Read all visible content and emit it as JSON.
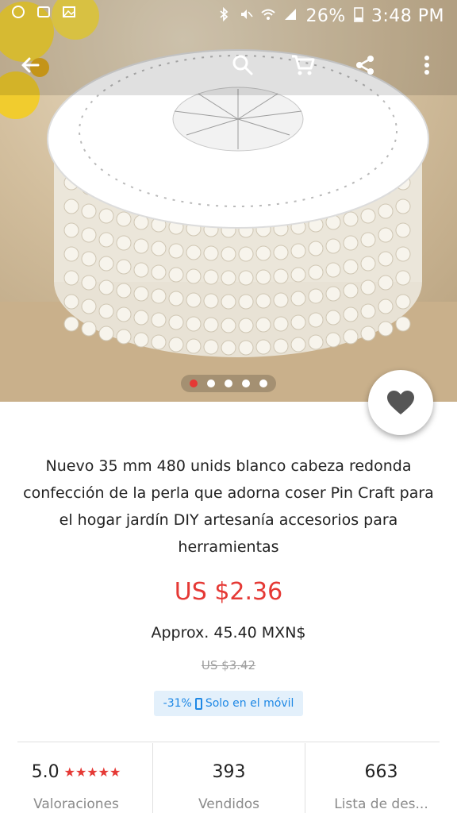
{
  "status_bar": {
    "battery": "26%",
    "time": "3:48 PM"
  },
  "gallery": {
    "total_images": 5,
    "active_index": 0
  },
  "colors": {
    "accent": "#e53935",
    "badge_text": "#1e88e5",
    "badge_bg": "#e3f0fb"
  },
  "product": {
    "title": "Nuevo 35 mm 480 unids blanco cabeza redonda confección de la perla que adorna coser Pin Craft para el hogar jardín DIY artesanía accesorios para herramientas",
    "price": "US $2.36",
    "approx_price": "Approx. 45.40 MXN$",
    "original_price": "US $3.42",
    "discount": "-31%",
    "mobile_only": "Solo en el móvil"
  },
  "stats": {
    "rating": {
      "value": "5.0",
      "stars": "★★★★★",
      "label": "Valoraciones"
    },
    "sold": {
      "value": "393",
      "label": "Vendidos"
    },
    "wishlist": {
      "value": "663",
      "label": "Lista de des..."
    }
  }
}
